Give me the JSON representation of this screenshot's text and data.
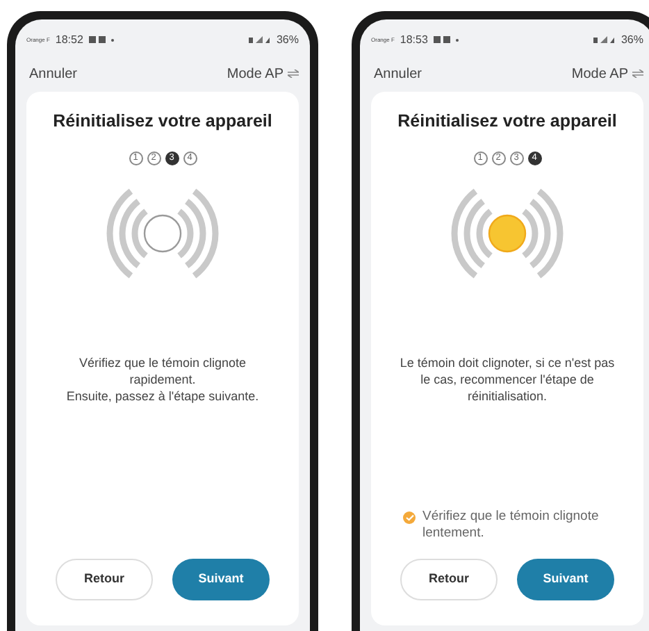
{
  "phones": [
    {
      "status": {
        "carrier": "Orange F",
        "time": "18:52",
        "battery": "36%"
      },
      "cancel": "Annuler",
      "mode": "Mode AP",
      "title": "Réinitialisez votre appareil",
      "steps": [
        {
          "label": "1",
          "selected": false
        },
        {
          "label": "2",
          "selected": false
        },
        {
          "label": "3",
          "selected": true
        },
        {
          "label": "4",
          "selected": false
        }
      ],
      "led_on": false,
      "message": [
        "Vérifiez que le témoin clignote rapidement.",
        "Ensuite, passez à l'étape suivante."
      ],
      "buttons": [
        {
          "label": "Retour",
          "kind": "secondary"
        },
        {
          "label": "Suivant",
          "kind": "primary"
        }
      ]
    },
    {
      "status": {
        "carrier": "Orange F",
        "time": "18:53",
        "battery": "36%"
      },
      "cancel": "Annuler",
      "mode": "Mode AP",
      "title": "Réinitialisez votre appareil",
      "steps": [
        {
          "label": "1",
          "selected": false
        },
        {
          "label": "2",
          "selected": false
        },
        {
          "label": "3",
          "selected": false
        },
        {
          "label": "4",
          "selected": true
        }
      ],
      "led_on": true,
      "message": [
        "Le témoin doit clignoter, si ce n'est pas le cas, recommencer l'étape de réinitialisation."
      ],
      "confirm": {
        "label": "Vérifiez que le témoin clignote lentement.",
        "checked": true
      },
      "buttons": [
        {
          "label": "Retour",
          "kind": "secondary"
        },
        {
          "label": "Suivant",
          "kind": "primary"
        }
      ]
    }
  ]
}
